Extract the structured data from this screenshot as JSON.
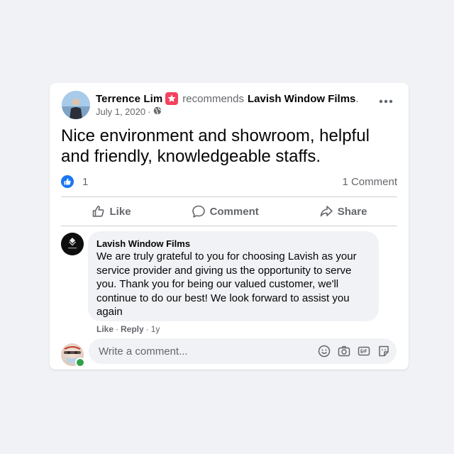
{
  "post": {
    "author": "Terrence Lim",
    "recommends": "recommends",
    "page": "Lavish Window Films",
    "page_suffix": ".",
    "date": "July 1, 2020",
    "date_separator": "·",
    "privacy_icon": "globe-icon",
    "text": "Nice environment and showroom, helpful and friendly, knowledgeable staffs."
  },
  "reactions": {
    "count": "1",
    "icon": "like-icon",
    "comments": "1 Comment"
  },
  "actions": {
    "like": "Like",
    "comment": "Comment",
    "share": "Share"
  },
  "comment": {
    "author": "Lavish Window Films",
    "text": "We are truly grateful to you for choosing Lavish as your service provider and giving us the opportunity to serve you. Thank you for being our valued customer, we'll continue to do our best! We look forward to assist you again",
    "like": "Like",
    "reply": "Reply",
    "sep": "·",
    "age": "1y"
  },
  "composer": {
    "placeholder": "Write a comment..."
  },
  "colors": {
    "brand_blue": "#1877f2",
    "recommend_badge": "#f3425f",
    "online_green": "#31a24c",
    "muted_text": "#65676b"
  }
}
